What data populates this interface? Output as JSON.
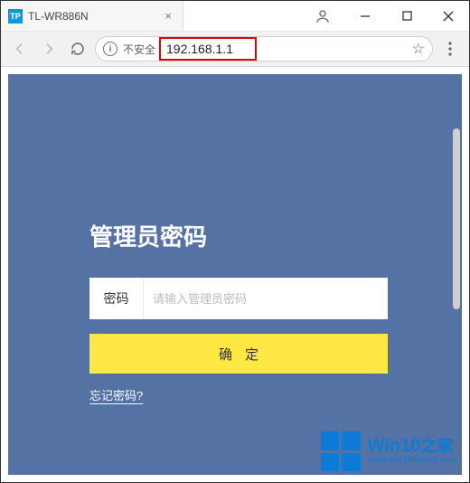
{
  "tab": {
    "favicon_text": "TP",
    "title": "TL-WR886N"
  },
  "address": {
    "insecure_label": "不安全",
    "url": "192.168.1.1"
  },
  "login": {
    "title": "管理员密码",
    "password_label": "密码",
    "password_placeholder": "请输入管理员密码",
    "confirm_label": "确定",
    "forgot_label": "忘记密码?"
  },
  "watermark": {
    "brand_en": "Win10",
    "brand_zh": "之家",
    "url": "www.win10xitong.com"
  }
}
